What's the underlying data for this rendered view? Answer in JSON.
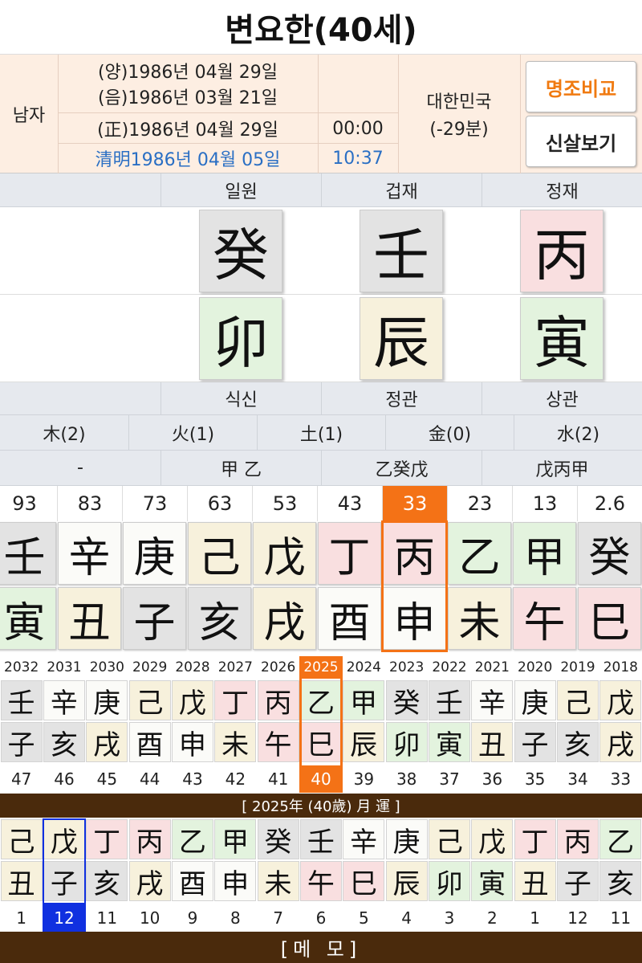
{
  "title": "변요한(40세)",
  "info": {
    "gender": "남자",
    "solar": "(양)1986년 04월 29일",
    "lunar": "(음)1986년 03월 21일",
    "corrected": "(正)1986년 04월 29일",
    "corrected_time": "00:00",
    "solar_term": "清明1986년 04월 05일",
    "solar_term_time": "10:37",
    "country": "대한민국",
    "offset": "(-29분)",
    "compare_button": "명조비교",
    "sinsal_button": "신살보기"
  },
  "top_labels": [
    "일원",
    "겁재",
    "정재"
  ],
  "stems": [
    {
      "char": "癸",
      "color": "g"
    },
    {
      "char": "壬",
      "color": "g"
    },
    {
      "char": "丙",
      "color": "p"
    }
  ],
  "branches": [
    {
      "char": "卯",
      "color": "gr"
    },
    {
      "char": "辰",
      "color": "y"
    },
    {
      "char": "寅",
      "color": "gr"
    }
  ],
  "bottom_labels": [
    "식신",
    "정관",
    "상관"
  ],
  "ohaeng": [
    "木(2)",
    "火(1)",
    "土(1)",
    "金(0)",
    "水(2)"
  ],
  "hidden_stems": [
    "-",
    "甲 乙",
    "乙癸戊",
    "戊丙甲"
  ],
  "daeun": {
    "ages": [
      "93",
      "83",
      "73",
      "63",
      "53",
      "43",
      "33",
      "23",
      "13",
      "2.6"
    ],
    "selected_index": 6,
    "stems": [
      {
        "char": "壬",
        "color": "g"
      },
      {
        "char": "辛",
        "color": "w"
      },
      {
        "char": "庚",
        "color": "w"
      },
      {
        "char": "己",
        "color": "y"
      },
      {
        "char": "戊",
        "color": "y"
      },
      {
        "char": "丁",
        "color": "p"
      },
      {
        "char": "丙",
        "color": "p"
      },
      {
        "char": "乙",
        "color": "gr"
      },
      {
        "char": "甲",
        "color": "gr"
      },
      {
        "char": "癸",
        "color": "g"
      }
    ],
    "branches": [
      {
        "char": "寅",
        "color": "gr"
      },
      {
        "char": "丑",
        "color": "y"
      },
      {
        "char": "子",
        "color": "g"
      },
      {
        "char": "亥",
        "color": "g"
      },
      {
        "char": "戌",
        "color": "y"
      },
      {
        "char": "酉",
        "color": "w"
      },
      {
        "char": "申",
        "color": "w"
      },
      {
        "char": "未",
        "color": "y"
      },
      {
        "char": "午",
        "color": "p"
      },
      {
        "char": "巳",
        "color": "p"
      }
    ]
  },
  "yearly": {
    "years": [
      "2032",
      "2031",
      "2030",
      "2029",
      "2028",
      "2027",
      "2026",
      "2025",
      "2024",
      "2023",
      "2022",
      "2021",
      "2020",
      "2019",
      "2018"
    ],
    "selected_index": 7,
    "stems": [
      {
        "char": "壬",
        "color": "g"
      },
      {
        "char": "辛",
        "color": "w"
      },
      {
        "char": "庚",
        "color": "w"
      },
      {
        "char": "己",
        "color": "y"
      },
      {
        "char": "戊",
        "color": "y"
      },
      {
        "char": "丁",
        "color": "p"
      },
      {
        "char": "丙",
        "color": "p"
      },
      {
        "char": "乙",
        "color": "gr"
      },
      {
        "char": "甲",
        "color": "gr"
      },
      {
        "char": "癸",
        "color": "g"
      },
      {
        "char": "壬",
        "color": "g"
      },
      {
        "char": "辛",
        "color": "w"
      },
      {
        "char": "庚",
        "color": "w"
      },
      {
        "char": "己",
        "color": "y"
      },
      {
        "char": "戊",
        "color": "y"
      }
    ],
    "branches": [
      {
        "char": "子",
        "color": "g"
      },
      {
        "char": "亥",
        "color": "g"
      },
      {
        "char": "戌",
        "color": "y"
      },
      {
        "char": "酉",
        "color": "w"
      },
      {
        "char": "申",
        "color": "w"
      },
      {
        "char": "未",
        "color": "y"
      },
      {
        "char": "午",
        "color": "p"
      },
      {
        "char": "巳",
        "color": "p"
      },
      {
        "char": "辰",
        "color": "y"
      },
      {
        "char": "卯",
        "color": "gr"
      },
      {
        "char": "寅",
        "color": "gr"
      },
      {
        "char": "丑",
        "color": "y"
      },
      {
        "char": "子",
        "color": "g"
      },
      {
        "char": "亥",
        "color": "g"
      },
      {
        "char": "戌",
        "color": "y"
      }
    ],
    "ages": [
      "47",
      "46",
      "45",
      "44",
      "43",
      "42",
      "41",
      "40",
      "39",
      "38",
      "37",
      "36",
      "35",
      "34",
      "33"
    ]
  },
  "monthly": {
    "title": "[ 2025年 (40歲) 月 運 ]",
    "selected_index": 1,
    "stems": [
      {
        "char": "己",
        "color": "y"
      },
      {
        "char": "戊",
        "color": "y"
      },
      {
        "char": "丁",
        "color": "p"
      },
      {
        "char": "丙",
        "color": "p"
      },
      {
        "char": "乙",
        "color": "gr"
      },
      {
        "char": "甲",
        "color": "gr"
      },
      {
        "char": "癸",
        "color": "g"
      },
      {
        "char": "壬",
        "color": "g"
      },
      {
        "char": "辛",
        "color": "w"
      },
      {
        "char": "庚",
        "color": "w"
      },
      {
        "char": "己",
        "color": "y"
      },
      {
        "char": "戊",
        "color": "y"
      },
      {
        "char": "丁",
        "color": "p"
      },
      {
        "char": "丙",
        "color": "p"
      },
      {
        "char": "乙",
        "color": "gr"
      }
    ],
    "branches": [
      {
        "char": "丑",
        "color": "y"
      },
      {
        "char": "子",
        "color": "g"
      },
      {
        "char": "亥",
        "color": "g"
      },
      {
        "char": "戌",
        "color": "y"
      },
      {
        "char": "酉",
        "color": "w"
      },
      {
        "char": "申",
        "color": "w"
      },
      {
        "char": "未",
        "color": "y"
      },
      {
        "char": "午",
        "color": "p"
      },
      {
        "char": "巳",
        "color": "p"
      },
      {
        "char": "辰",
        "color": "y"
      },
      {
        "char": "卯",
        "color": "gr"
      },
      {
        "char": "寅",
        "color": "gr"
      },
      {
        "char": "丑",
        "color": "y"
      },
      {
        "char": "子",
        "color": "g"
      },
      {
        "char": "亥",
        "color": "g"
      }
    ],
    "months": [
      "1",
      "12",
      "11",
      "10",
      "9",
      "8",
      "7",
      "6",
      "5",
      "4",
      "3",
      "2",
      "1",
      "12",
      "11"
    ]
  },
  "memo_label": "[메  모]"
}
